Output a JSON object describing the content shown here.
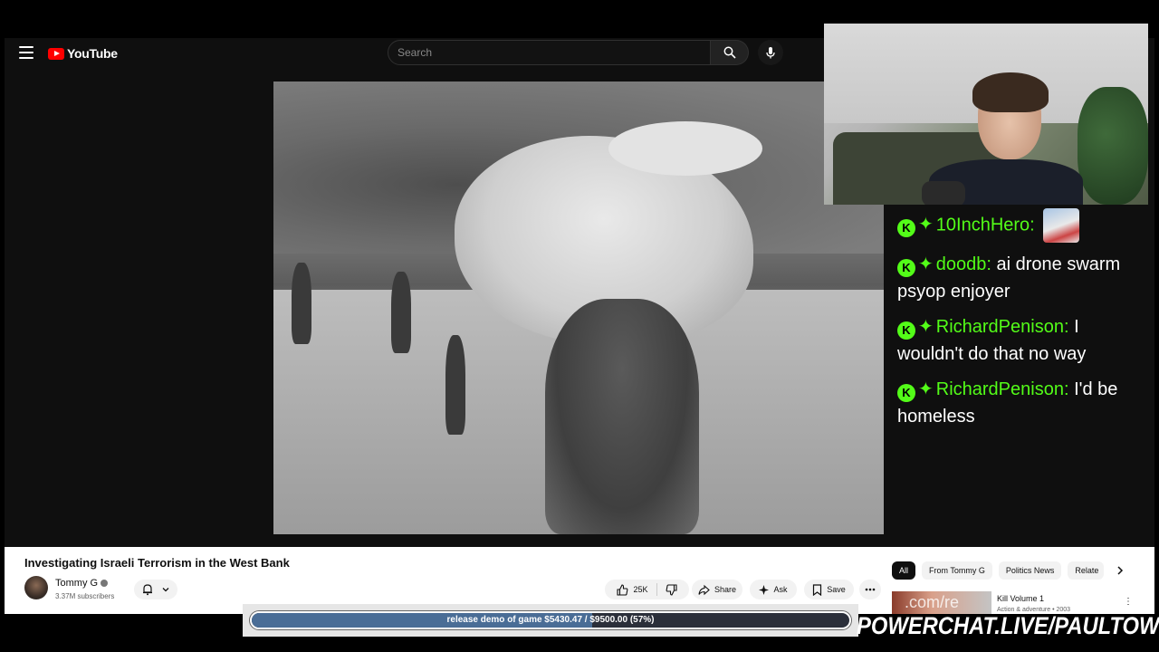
{
  "header": {
    "logo_text": "YouTube",
    "search_placeholder": "Search",
    "icons": {
      "menu": "hamburger-menu-icon",
      "search": "search-icon",
      "mic": "microphone-icon"
    }
  },
  "video": {
    "title": "Investigating Israeli Terrorism in the West Bank",
    "channel": "Tommy G",
    "subscribers": "3.37M subscribers",
    "likes": "25K",
    "share_label": "Share",
    "ask_label": "Ask",
    "save_label": "Save"
  },
  "chips": [
    "All",
    "From Tommy G",
    "Politics News",
    "Relate"
  ],
  "recommendation": {
    "title": "Kill Volume 1",
    "meta": "Action & adventure • 2003",
    "thumb_text": ".com/re"
  },
  "chat": [
    {
      "user": "10InchHero:",
      "text": ""
    },
    {
      "user": "doodb:",
      "text": "ai drone swarm psyop enjoyer"
    },
    {
      "user": "RichardPenison:",
      "text": "I wouldn't do that no way"
    },
    {
      "user": "RichardPenison:",
      "text": "I'd be homeless"
    }
  ],
  "goal": {
    "text": "release demo of game $5430.47 / $9500.00 (57%)",
    "progress": 0.57
  },
  "brand": "POWERCHAT.LIVE/PAULTOWN",
  "colors": {
    "accent_green": "#53fc18",
    "yt_red": "#ff0000",
    "goal_fill": "#4a6d96"
  }
}
